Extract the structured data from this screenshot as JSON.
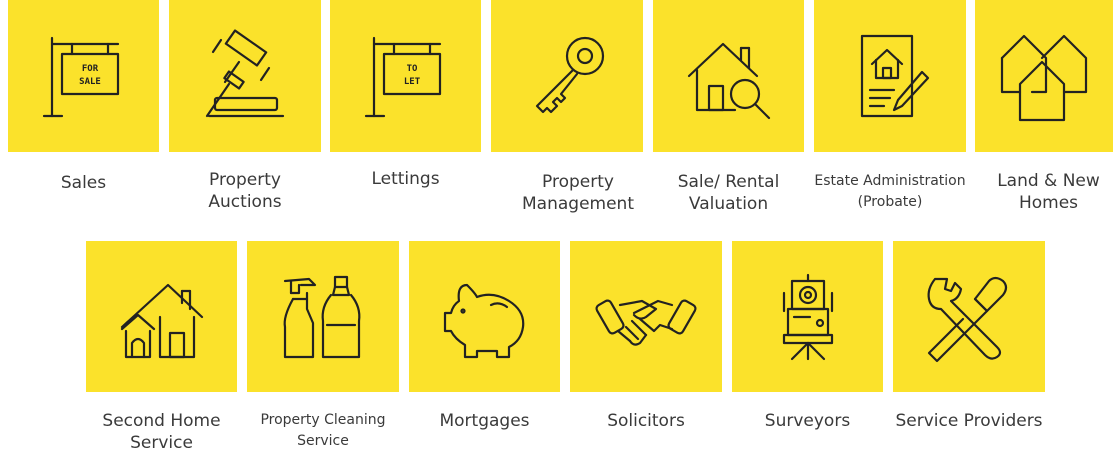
{
  "row1": [
    {
      "label": "Sales",
      "icon": "for-sale-sign-icon"
    },
    {
      "label": "Property Auctions",
      "icon": "auction-gavel-icon"
    },
    {
      "label": "Lettings",
      "icon": "to-let-sign-icon"
    },
    {
      "label": "Property Management",
      "icon": "key-icon"
    },
    {
      "label": "Sale/ Rental Valuation",
      "icon": "house-magnifier-icon"
    },
    {
      "label": "Estate Administration (Probate)",
      "icon": "document-house-pen-icon"
    },
    {
      "label": "Land & New Homes",
      "icon": "multiple-houses-icon"
    }
  ],
  "row2": [
    {
      "label": "Second Home Service",
      "icon": "home-with-annex-icon"
    },
    {
      "label": "Property Cleaning Service",
      "icon": "cleaning-bottles-icon"
    },
    {
      "label": "Mortgages",
      "icon": "piggy-bank-icon"
    },
    {
      "label": "Solicitors",
      "icon": "handshake-icon"
    },
    {
      "label": "Surveyors",
      "icon": "survey-instrument-icon"
    },
    {
      "label": "Service Providers",
      "icon": "tools-icon"
    }
  ],
  "signs": {
    "for_sale_line1": "FOR",
    "for_sale_line2": "SALE",
    "to_let_line1": "TO",
    "to_let_line2": "LET"
  },
  "colors": {
    "tile": "#fbe22b",
    "icon": "#222222",
    "text": "#3a3a3a"
  }
}
